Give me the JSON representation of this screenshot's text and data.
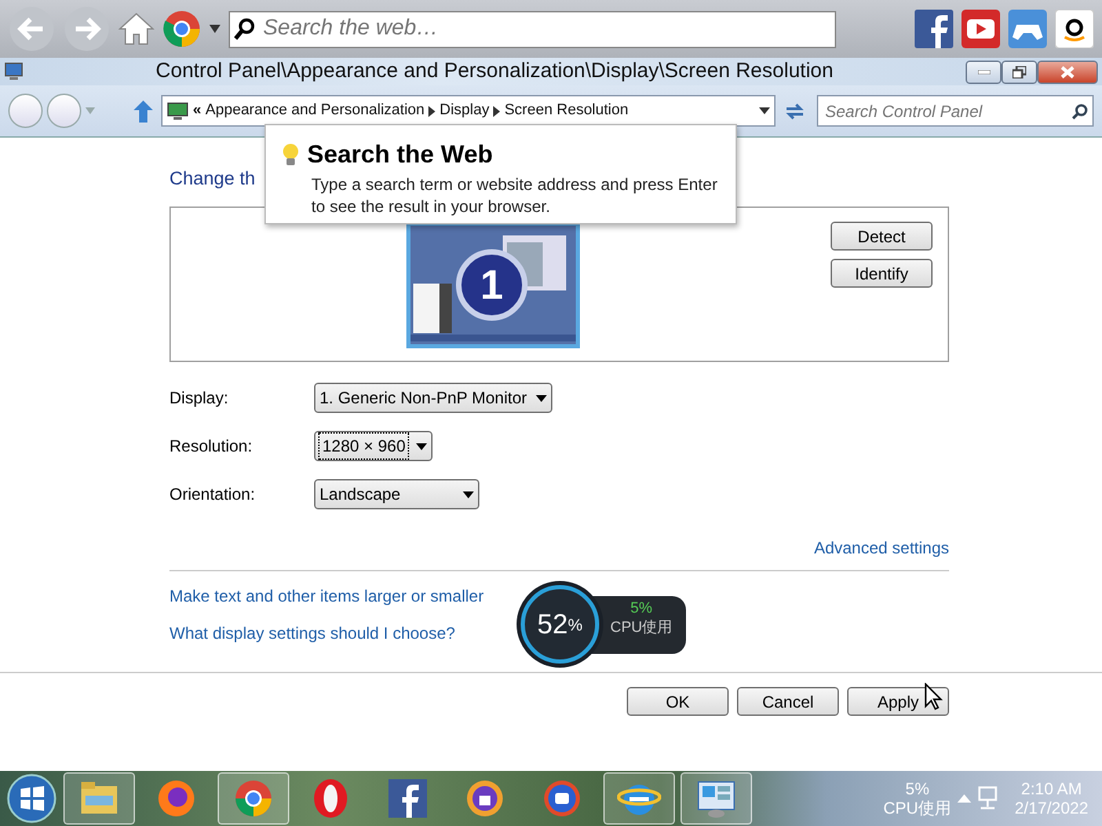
{
  "browser_toolbar": {
    "search": {
      "placeholder": "Search the web…"
    }
  },
  "window": {
    "title": "Control Panel\\Appearance and Personalization\\Display\\Screen Resolution"
  },
  "address_bar": {
    "prefix": "«",
    "crumbs": [
      "Appearance and Personalization",
      "Display",
      "Screen Resolution"
    ]
  },
  "search": {
    "placeholder": "Search Control Panel"
  },
  "tooltip": {
    "title": "Search the Web",
    "text": "Type a search term or website address and press Enter to see the result in your browser."
  },
  "heading": "Change th",
  "monitor_panel": {
    "monitor_number": "1",
    "buttons": [
      "Detect",
      "Identify"
    ]
  },
  "settings": [
    {
      "label": "Display:",
      "value": "1. Generic Non-PnP Monitor",
      "focused": false
    },
    {
      "label": "Resolution:",
      "value": "1280 × 960",
      "focused": true
    },
    {
      "label": "Orientation:",
      "value": "Landscape",
      "focused": false
    }
  ],
  "advanced_link": "Advanced settings",
  "links": [
    "Make text and other items larger or smaller",
    "What display settings should I choose?"
  ],
  "buttons": [
    "OK",
    "Cancel",
    "Apply"
  ],
  "cpu_widget": {
    "memory": "52",
    "unit": "%",
    "cpu": "5%",
    "cpu_label": "CPU使用"
  },
  "taskbar": {
    "apps": [
      {
        "kind": "folder",
        "running": true
      },
      {
        "kind": "firefox",
        "running": false
      },
      {
        "kind": "chrome",
        "running": true
      },
      {
        "kind": "opera",
        "running": false
      },
      {
        "kind": "facebook",
        "running": false
      },
      {
        "kind": "vpn",
        "running": false
      },
      {
        "kind": "ur",
        "running": false
      },
      {
        "kind": "ie",
        "running": true
      },
      {
        "kind": "control",
        "running": true
      }
    ]
  },
  "tray": {
    "cpu": "5%",
    "cpu_label": "CPU使用",
    "time": "2:10 AM",
    "date": "2/17/2022"
  }
}
